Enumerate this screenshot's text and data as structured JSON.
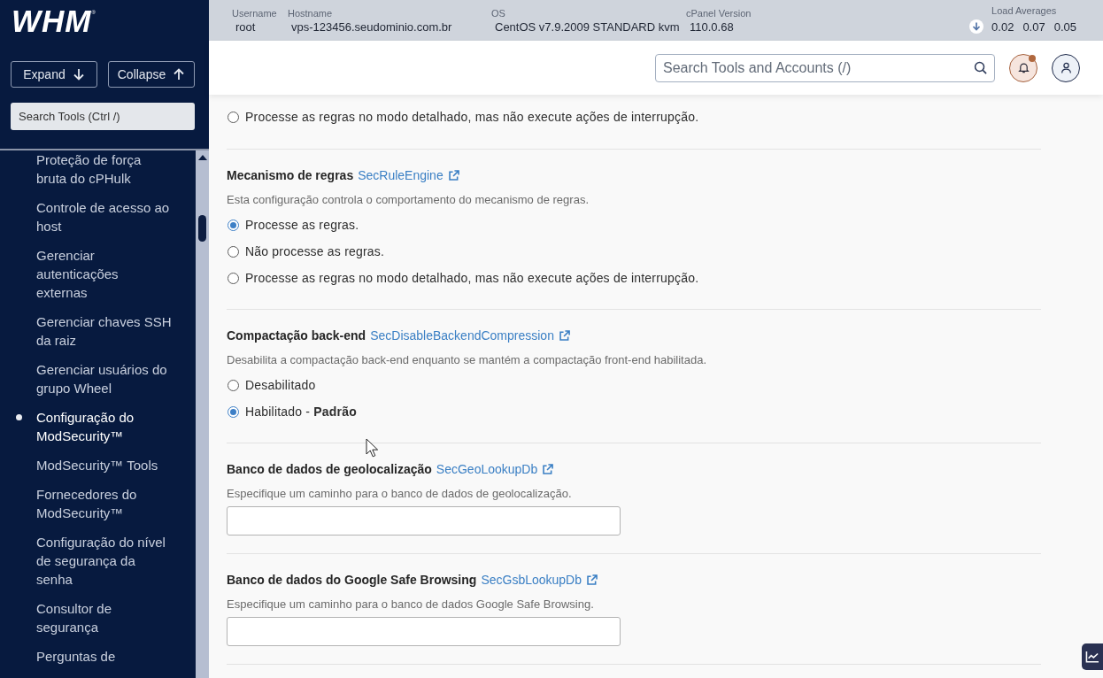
{
  "sidebar": {
    "logo": "WHM$^{®}$",
    "buttons": [
      {
        "label": "Expand",
        "kind": "expand"
      },
      {
        "label": "Collapse",
        "kind": "collapse"
      }
    ],
    "search": {
      "placeholder": "Search Tools (Ctrl /)"
    },
    "items": [
      {
        "label": "Proteção de força bruta do cPHulk",
        "selected": false
      },
      {
        "label": "Controle de acesso ao host",
        "selected": false
      },
      {
        "label": "Gerenciar autenticações externas",
        "selected": false
      },
      {
        "label": "Gerenciar chaves SSH da raiz",
        "selected": false
      },
      {
        "label": "Gerenciar usuários do grupo Wheel",
        "selected": false
      },
      {
        "label": "Configuração do ModSecurity™",
        "selected": true
      },
      {
        "label": "ModSecurity™ Tools",
        "selected": false
      },
      {
        "label": "Fornecedores do ModSecurity™",
        "selected": false
      },
      {
        "label": "Configuração do nível de segurança da senha",
        "selected": false
      },
      {
        "label": "Consultor de segurança",
        "selected": false
      },
      {
        "label": "Perguntas de",
        "selected": false
      }
    ]
  },
  "server_info": [
    {
      "label": "Username",
      "value": "root"
    },
    {
      "label": "Hostname",
      "value": "vps-123456.seudominio.com.br"
    },
    {
      "label": "OS",
      "value": "CentOS v7.9.2009 STANDARD kvm"
    },
    {
      "label": "cPanel Version",
      "value": "110.0.68"
    }
  ],
  "load_averages": {
    "label": "Load Averages",
    "values": [
      "0.02",
      "0.07",
      "0.05"
    ]
  },
  "search": {
    "placeholder": "Search Tools and Accounts (/)"
  },
  "notifications": {
    "unread": true
  },
  "settings": [
    {
      "kind": "choice",
      "options": [
        {
          "label": "Processe as regras no modo detalhado, mas não execute ações de interrupção.",
          "selected": false
        }
      ]
    },
    {
      "kind": "choice",
      "title": "Mecanismo de regras",
      "directive": "SecRuleEngine",
      "description": "Esta configuração controla o comportamento do mecanismo de regras.",
      "options": [
        {
          "label": "Processe as regras.",
          "selected": true
        },
        {
          "label": "Não processe as regras.",
          "selected": false
        },
        {
          "label": "Processe as regras no modo detalhado, mas não execute ações de interrupção.",
          "selected": false
        }
      ]
    },
    {
      "kind": "choice",
      "title": "Compactação back-end",
      "directive": "SecDisableBackendCompression",
      "description": "Desabilita a compactação back-end enquanto se mantém a compactação front-end habilitada.",
      "options": [
        {
          "label": "Desabilitado",
          "selected": false
        },
        {
          "label": "Habilitado - **Padrão**",
          "selected": true
        }
      ]
    },
    {
      "kind": "path",
      "title": "Banco de dados de geolocalização",
      "directive": "SecGeoLookupDb",
      "description": "Especifique um caminho para o banco de dados de geolocalização."
    },
    {
      "kind": "path",
      "title": "Banco de dados do Google Safe Browsing",
      "directive": "SecGsbLookupDb",
      "description": "Especifique um caminho para o banco de dados Google Safe Browsing."
    }
  ]
}
